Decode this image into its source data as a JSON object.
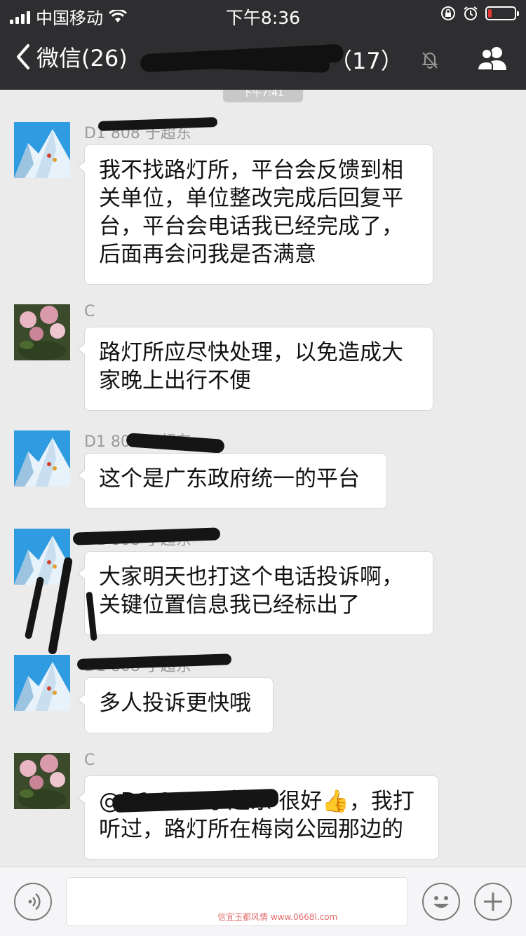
{
  "status_bar": {
    "carrier": "中国移动",
    "time": "下午8:36"
  },
  "nav": {
    "back_label": "微信(26)",
    "title": "（17）"
  },
  "time_chip": "下午7:41",
  "messages": [
    {
      "sender": "D1 808 于超东",
      "avatar": "mountain-avatar",
      "lines": [
        "我不找路灯所，平台会反馈到相",
        "关单位，单位整改完成后回复平",
        "台，平台会电话我已经完成了，",
        "后面再会问我是否满意"
      ]
    },
    {
      "sender": "C",
      "avatar": "flower-avatar",
      "lines": [
        "路灯所应尽快处理，以免造成大",
        "家晚上出行不便"
      ]
    },
    {
      "sender": "D1 808 于超东",
      "avatar": "mountain-avatar",
      "lines": [
        "这个是广东政府统一的平台"
      ]
    },
    {
      "sender": "D1 808 于超东",
      "avatar": "mountain-avatar",
      "lines": [
        "大家明天也打这个电话投诉啊，",
        "关键位置信息我已经标出了"
      ]
    },
    {
      "sender": "D1 808 于超东",
      "avatar": "mountain-avatar",
      "lines": [
        "多人投诉更快哦"
      ]
    },
    {
      "sender": "C",
      "avatar": "flower-avatar",
      "lines": [
        "@D1 808 于超东 很好👍，我打",
        "听过，路灯所在梅岗公园那边的"
      ]
    }
  ],
  "input_bar": {
    "voice_icon": "voice-icon",
    "emoji_icon": "emoji-icon",
    "plus_icon": "plus-icon",
    "watermark": "信宜玉都风情 www.0668l.com"
  }
}
